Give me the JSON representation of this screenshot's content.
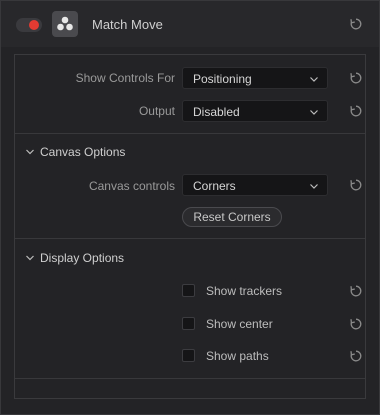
{
  "node": {
    "title": "Match Move",
    "enabled": true
  },
  "controls": {
    "show_controls_for_label": "Show Controls For",
    "show_controls_for_value": "Positioning",
    "output_label": "Output",
    "output_value": "Disabled"
  },
  "canvas_options": {
    "section_title": "Canvas Options",
    "canvas_controls_label": "Canvas controls",
    "canvas_controls_value": "Corners",
    "reset_corners_label": "Reset Corners"
  },
  "display_options": {
    "section_title": "Display Options",
    "items": [
      {
        "label": "Show trackers",
        "checked": false
      },
      {
        "label": "Show center",
        "checked": false
      },
      {
        "label": "Show paths",
        "checked": false
      }
    ]
  },
  "icons": {
    "toggle": "power-toggle-icon",
    "effect": "effect-nodes-icon",
    "reset": "reset-arrow-icon",
    "dropdown": "chevron-down-icon",
    "section": "chevron-collapse-icon"
  },
  "colors": {
    "toggle_on": "#e23b32",
    "panel_bg": "#232326"
  }
}
